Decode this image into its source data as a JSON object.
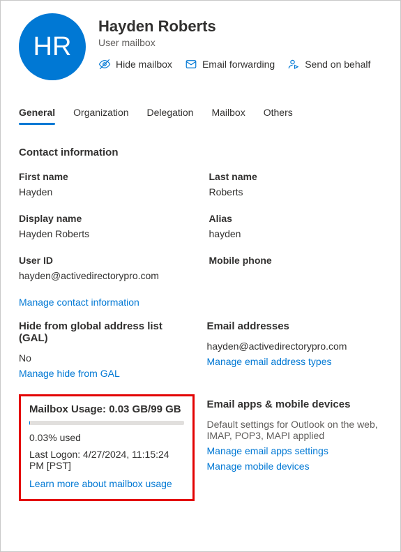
{
  "header": {
    "initials": "HR",
    "title": "Hayden Roberts",
    "subtitle": "User mailbox",
    "actions": {
      "hide": "Hide mailbox",
      "forward": "Email forwarding",
      "behalf": "Send on behalf"
    }
  },
  "tabs": {
    "general": "General",
    "organization": "Organization",
    "delegation": "Delegation",
    "mailbox": "Mailbox",
    "others": "Others"
  },
  "sections": {
    "contact_info": "Contact information"
  },
  "fields": {
    "first_name_label": "First name",
    "first_name_value": "Hayden",
    "last_name_label": "Last name",
    "last_name_value": "Roberts",
    "display_name_label": "Display name",
    "display_name_value": "Hayden Roberts",
    "alias_label": "Alias",
    "alias_value": "hayden",
    "user_id_label": "User ID",
    "user_id_value": "hayden@activedirectorypro.com",
    "mobile_label": "Mobile phone",
    "mobile_value": ""
  },
  "links": {
    "manage_contact": "Manage contact information",
    "manage_gal": "Manage hide from GAL",
    "manage_email_types": "Manage email address types",
    "learn_usage": "Learn more about mailbox usage",
    "manage_email_apps": "Manage email apps settings",
    "manage_mobile": "Manage mobile devices"
  },
  "gal": {
    "label": "Hide from global address list (GAL)",
    "value": "No"
  },
  "email_addresses": {
    "label": "Email addresses",
    "value": "hayden@activedirectorypro.com"
  },
  "usage": {
    "title": "Mailbox Usage: 0.03 GB/99 GB",
    "percent": "0.03% used",
    "last_logon": "Last Logon: 4/27/2024, 11:15:24 PM [PST]"
  },
  "apps": {
    "title": "Email apps & mobile devices",
    "desc": "Default settings for Outlook on the web, IMAP, POP3, MAPI applied"
  }
}
